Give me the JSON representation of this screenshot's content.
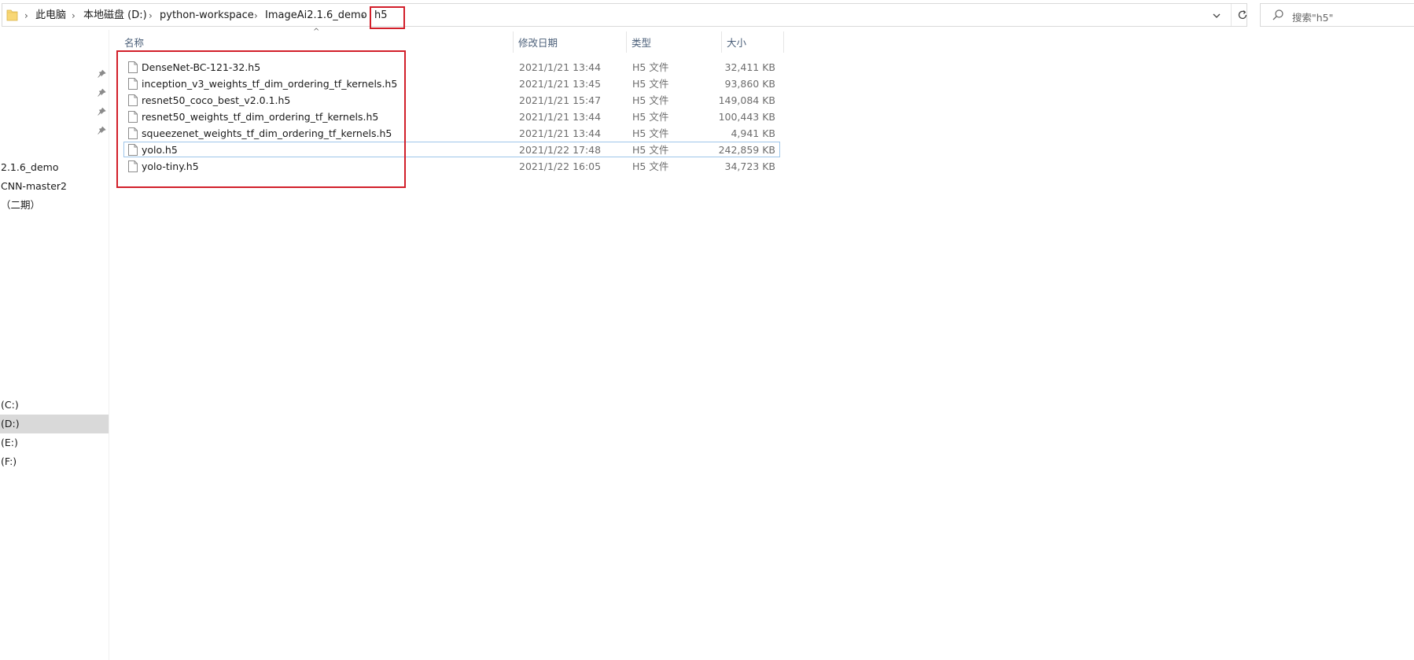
{
  "breadcrumb": {
    "items": [
      "此电脑",
      "本地磁盘 (D:)",
      "python-workspace",
      "ImageAi2.1.6_demo"
    ],
    "current": "h5"
  },
  "search": {
    "placeholder": "搜索\"h5\""
  },
  "nav": {
    "items": [
      {
        "label": "2.1.6_demo"
      },
      {
        "label": "CNN-master2"
      },
      {
        "label": "（二期）"
      },
      {
        "label": "(C:)"
      },
      {
        "label": "(D:)"
      },
      {
        "label": "(E:)"
      },
      {
        "label": "(F:)"
      }
    ],
    "selected": "(D:)"
  },
  "columns": {
    "name": "名称",
    "date": "修改日期",
    "type": "类型",
    "size": "大小"
  },
  "files": [
    {
      "name": "DenseNet-BC-121-32.h5",
      "date": "2021/1/21 13:44",
      "type": "H5 文件",
      "size": "32,411 KB"
    },
    {
      "name": "inception_v3_weights_tf_dim_ordering_tf_kernels.h5",
      "date": "2021/1/21 13:45",
      "type": "H5 文件",
      "size": "93,860 KB"
    },
    {
      "name": "resnet50_coco_best_v2.0.1.h5",
      "date": "2021/1/21 15:47",
      "type": "H5 文件",
      "size": "149,084 KB"
    },
    {
      "name": "resnet50_weights_tf_dim_ordering_tf_kernels.h5",
      "date": "2021/1/21 13:44",
      "type": "H5 文件",
      "size": "100,443 KB"
    },
    {
      "name": "squeezenet_weights_tf_dim_ordering_tf_kernels.h5",
      "date": "2021/1/21 13:44",
      "type": "H5 文件",
      "size": "4,941 KB"
    },
    {
      "name": "yolo.h5",
      "date": "2021/1/22 17:48",
      "type": "H5 文件",
      "size": "242,859 KB"
    },
    {
      "name": "yolo-tiny.h5",
      "date": "2021/1/22 16:05",
      "type": "H5 文件",
      "size": "34,723 KB"
    }
  ],
  "focused_file": "yolo.h5",
  "icons": {
    "folder": "folder-icon",
    "refresh": "refresh-icon",
    "dropdown": "chevron-down-icon",
    "search": "search-icon",
    "pin": "pin-icon",
    "file": "file-icon"
  },
  "colors": {
    "annotation": "#d21f2a",
    "selection": "#d9d9d9",
    "focus_border": "#9fc6ea",
    "header_text": "#4c607a"
  }
}
